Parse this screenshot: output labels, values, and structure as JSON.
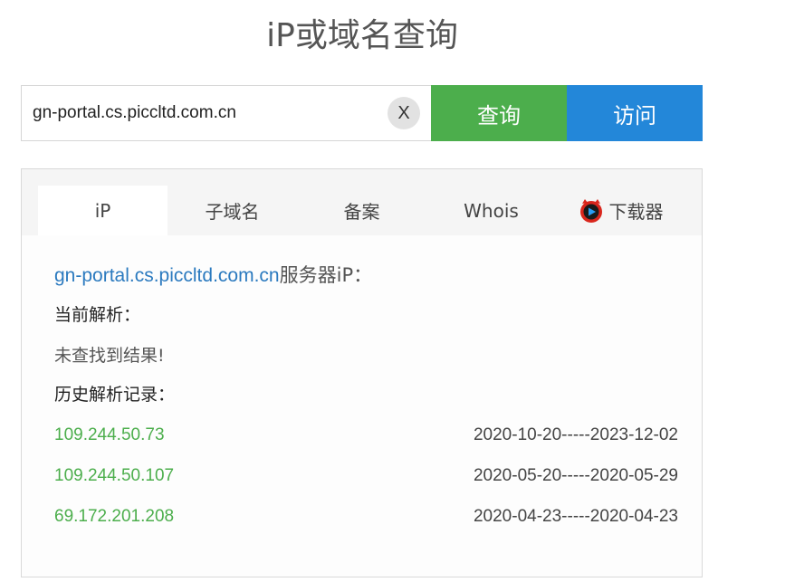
{
  "page": {
    "title": "iP或域名查询"
  },
  "search": {
    "value": "gn-portal.cs.piccltd.com.cn",
    "clear_label": "X",
    "query_label": "查询",
    "visit_label": "访问"
  },
  "tabs": [
    {
      "label": "iP",
      "active": true
    },
    {
      "label": "子域名",
      "active": false
    },
    {
      "label": "备案",
      "active": false
    },
    {
      "label": "Whois",
      "active": false
    },
    {
      "label": "下载器",
      "active": false,
      "icon": "downloader-app-icon"
    }
  ],
  "result": {
    "domain": "gn-portal.cs.piccltd.com.cn",
    "server_ip_suffix": "服务器iP：",
    "current_label": "当前解析：",
    "not_found": "未查找到结果!",
    "history_label": "历史解析记录：",
    "history": [
      {
        "ip": "109.244.50.73",
        "range": "2020-10-20-----2023-12-02"
      },
      {
        "ip": "109.244.50.107",
        "range": "2020-05-20-----2020-05-29"
      },
      {
        "ip": "69.172.201.208",
        "range": "2020-04-23-----2020-04-23"
      }
    ]
  },
  "colors": {
    "query_button": "#4cae4c",
    "visit_button": "#2387d9",
    "domain_link": "#2b7abf",
    "ip_link": "#4cae4c"
  }
}
